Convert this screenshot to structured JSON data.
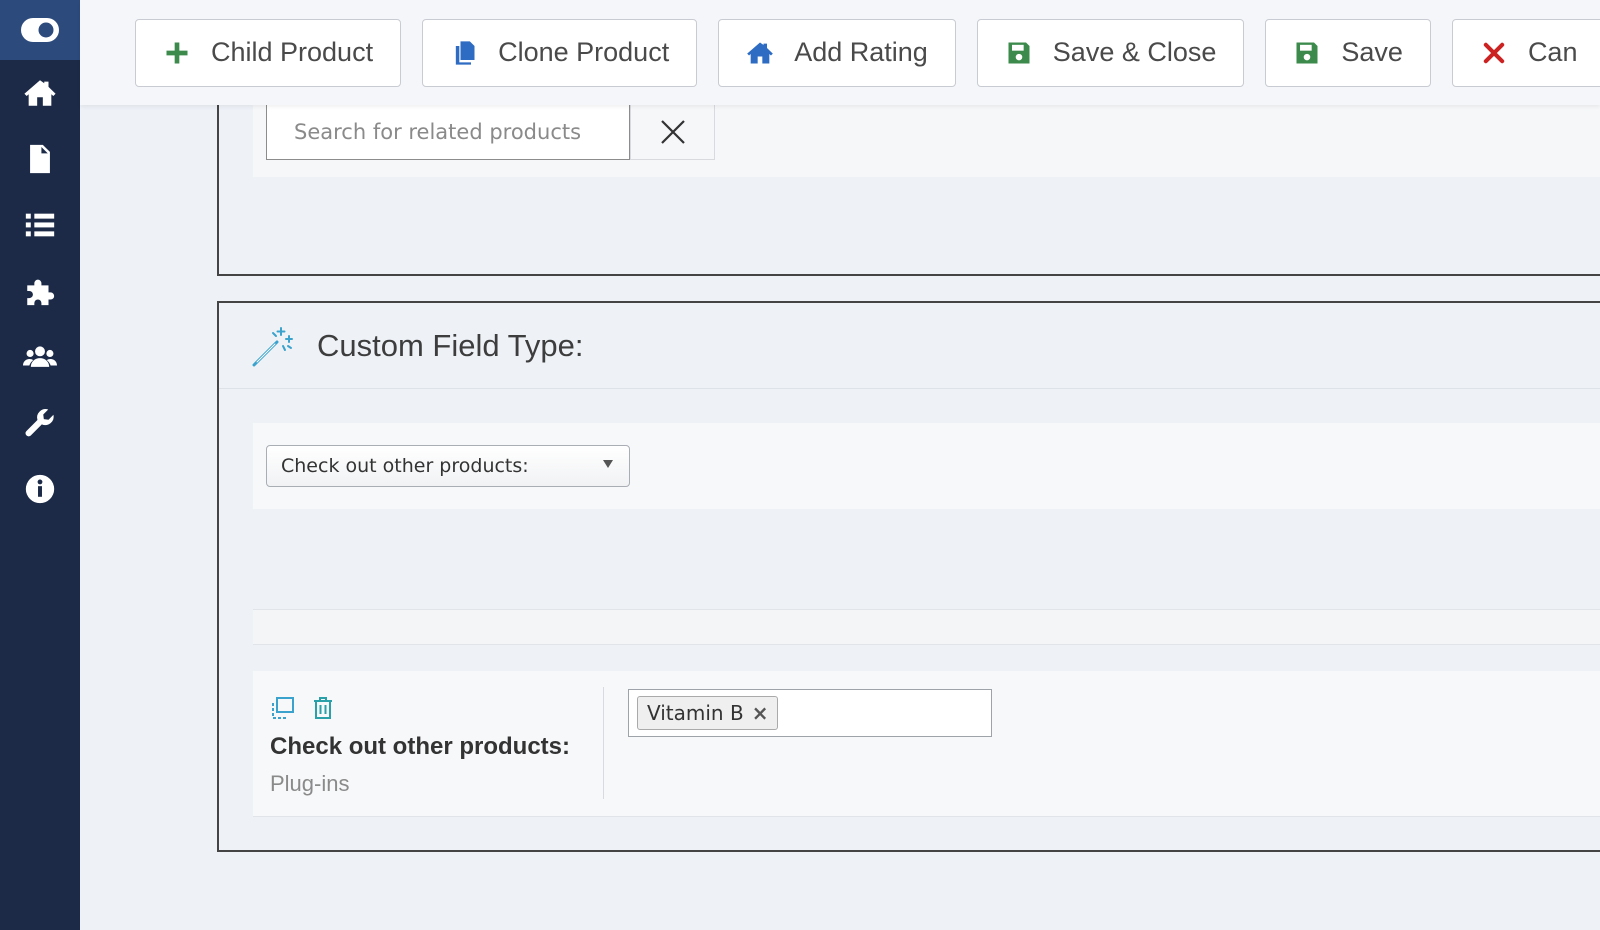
{
  "sidebar": {
    "items": [
      {
        "icon": "toggle-icon",
        "name": "toggle-menu"
      },
      {
        "icon": "home-icon",
        "name": "home"
      },
      {
        "icon": "document-icon",
        "name": "content"
      },
      {
        "icon": "list-icon",
        "name": "menus"
      },
      {
        "icon": "puzzle-icon",
        "name": "components"
      },
      {
        "icon": "users-icon",
        "name": "users"
      },
      {
        "icon": "wrench-icon",
        "name": "system"
      },
      {
        "icon": "info-icon",
        "name": "help"
      }
    ]
  },
  "toolbar": {
    "child_product": "Child Product",
    "clone_product": "Clone Product",
    "add_rating": "Add Rating",
    "save_close": "Save & Close",
    "save": "Save",
    "cancel": "Can"
  },
  "related": {
    "search_placeholder": "Search for related products"
  },
  "custom_field": {
    "title": "Custom Field Type:",
    "select_value": "Check out other products:",
    "field_label": "Check out other products:",
    "field_sub": "Plug-ins",
    "tags": [
      "Vitamin B"
    ],
    "tag_remove": "×"
  },
  "colors": {
    "sidebar_bg": "#1c2a47",
    "sidebar_logo_bg": "#2c4a7c",
    "icon_green": "#3c8a4c",
    "icon_blue": "#2d6cc2",
    "icon_red": "#cc2222",
    "accent_teal": "#3aa2cc"
  }
}
